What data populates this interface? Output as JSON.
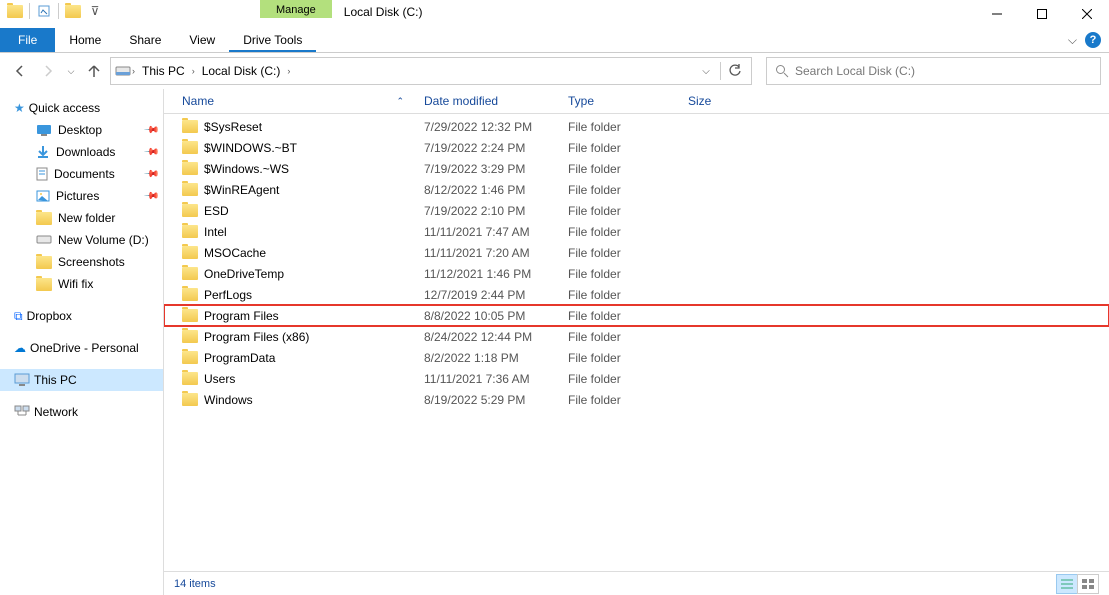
{
  "title": "Local Disk (C:)",
  "contextual_tab": "Manage",
  "ribbon": {
    "file": "File",
    "home": "Home",
    "share": "Share",
    "view": "View",
    "drive": "Drive Tools"
  },
  "address": {
    "this_pc": "This PC",
    "drive": "Local Disk (C:)"
  },
  "search_placeholder": "Search Local Disk (C:)",
  "sidebar": {
    "quick_access": "Quick access",
    "desktop": "Desktop",
    "downloads": "Downloads",
    "documents": "Documents",
    "pictures": "Pictures",
    "new_folder": "New folder",
    "new_volume": "New Volume (D:)",
    "screenshots": "Screenshots",
    "wifi_fix": "Wifi fix",
    "dropbox": "Dropbox",
    "onedrive": "OneDrive - Personal",
    "this_pc": "This PC",
    "network": "Network"
  },
  "columns": {
    "name": "Name",
    "date": "Date modified",
    "type": "Type",
    "size": "Size"
  },
  "files": [
    {
      "name": "$SysReset",
      "date": "7/29/2022 12:32 PM",
      "type": "File folder"
    },
    {
      "name": "$WINDOWS.~BT",
      "date": "7/19/2022 2:24 PM",
      "type": "File folder"
    },
    {
      "name": "$Windows.~WS",
      "date": "7/19/2022 3:29 PM",
      "type": "File folder"
    },
    {
      "name": "$WinREAgent",
      "date": "8/12/2022 1:46 PM",
      "type": "File folder"
    },
    {
      "name": "ESD",
      "date": "7/19/2022 2:10 PM",
      "type": "File folder"
    },
    {
      "name": "Intel",
      "date": "11/11/2021 7:47 AM",
      "type": "File folder"
    },
    {
      "name": "MSOCache",
      "date": "11/11/2021 7:20 AM",
      "type": "File folder"
    },
    {
      "name": "OneDriveTemp",
      "date": "11/12/2021 1:46 PM",
      "type": "File folder"
    },
    {
      "name": "PerfLogs",
      "date": "12/7/2019 2:44 PM",
      "type": "File folder"
    },
    {
      "name": "Program Files",
      "date": "8/8/2022 10:05 PM",
      "type": "File folder",
      "highlight": true
    },
    {
      "name": "Program Files (x86)",
      "date": "8/24/2022 12:44 PM",
      "type": "File folder"
    },
    {
      "name": "ProgramData",
      "date": "8/2/2022 1:18 PM",
      "type": "File folder"
    },
    {
      "name": "Users",
      "date": "11/11/2021 7:36 AM",
      "type": "File folder"
    },
    {
      "name": "Windows",
      "date": "8/19/2022 5:29 PM",
      "type": "File folder"
    }
  ],
  "status": "14 items"
}
